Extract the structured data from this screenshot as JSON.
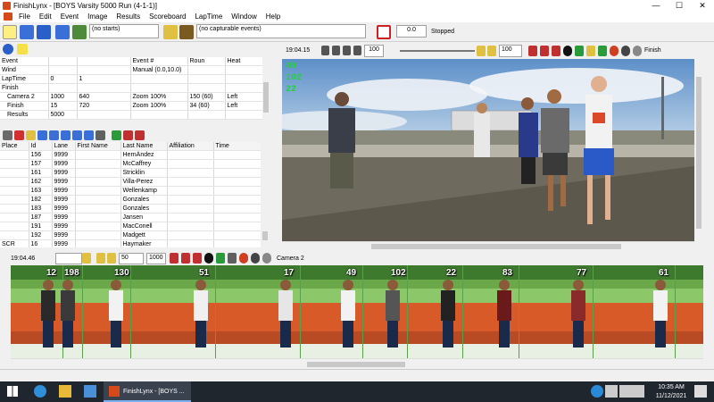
{
  "window": {
    "title": "FinishLynx - [BOYS  Varsity 5000 Run (4-1-1)]",
    "minimize": "—",
    "maximize": "☐",
    "close": "✕"
  },
  "menu": [
    "File",
    "Edit",
    "Event",
    "Image",
    "Results",
    "Scoreboard",
    "LapTime",
    "Window",
    "Help"
  ],
  "toolbar": {
    "starts_select": "(no starts)",
    "capture_select": "(no capturable events)",
    "time_value": "0.0",
    "status": "Stopped"
  },
  "event_panel": {
    "rows": [
      {
        "c0": "Event",
        "c1": "",
        "c2": "",
        "c3": "Event #",
        "c4": "Roun",
        "c5": "Heat"
      },
      {
        "c0": "Wind",
        "c1": "",
        "c2": "",
        "c3": "Manual (0.0,10.0)",
        "c4": "",
        "c5": ""
      },
      {
        "c0": "LapTime",
        "c1": "0",
        "c2": "1",
        "c3": "",
        "c4": "",
        "c5": ""
      },
      {
        "c0": "Finish",
        "c1": "",
        "c2": "",
        "c3": "",
        "c4": "",
        "c5": ""
      },
      {
        "c0": "Camera 2",
        "c1": "1000",
        "c2": "640",
        "c3": "Zoom 100%",
        "c4": "150  (60)",
        "c5": "Left"
      },
      {
        "c0": "Finish",
        "c1": "15",
        "c2": "720",
        "c3": "Zoom 100%",
        "c4": "34  (60)",
        "c5": "Left"
      },
      {
        "c0": "Results",
        "c1": "5000",
        "c2": "",
        "c3": "",
        "c4": "",
        "c5": ""
      }
    ]
  },
  "results": {
    "headers": [
      "Place",
      "Id",
      "Lane",
      "First Name",
      "Last Name",
      "Affiliation",
      "Time"
    ],
    "rows": [
      {
        "place": "",
        "id": "156",
        "lane": "9999",
        "first": "",
        "last": "HernÁndez",
        "aff": "",
        "time": ""
      },
      {
        "place": "",
        "id": "157",
        "lane": "9999",
        "first": "",
        "last": "McCaffrey",
        "aff": "",
        "time": ""
      },
      {
        "place": "",
        "id": "161",
        "lane": "9999",
        "first": "",
        "last": "Stricklin",
        "aff": "",
        "time": ""
      },
      {
        "place": "",
        "id": "162",
        "lane": "9999",
        "first": "",
        "last": "Villa-Perez",
        "aff": "",
        "time": ""
      },
      {
        "place": "",
        "id": "163",
        "lane": "9999",
        "first": "",
        "last": "Wellenkamp",
        "aff": "",
        "time": ""
      },
      {
        "place": "",
        "id": "182",
        "lane": "9999",
        "first": "",
        "last": "Gonzales",
        "aff": "",
        "time": ""
      },
      {
        "place": "",
        "id": "183",
        "lane": "9999",
        "first": "",
        "last": "Gonzales",
        "aff": "",
        "time": ""
      },
      {
        "place": "",
        "id": "187",
        "lane": "9999",
        "first": "",
        "last": "Jansen",
        "aff": "",
        "time": ""
      },
      {
        "place": "",
        "id": "191",
        "lane": "9999",
        "first": "",
        "last": "MacConell",
        "aff": "",
        "time": ""
      },
      {
        "place": "",
        "id": "192",
        "lane": "9999",
        "first": "",
        "last": "Madgett",
        "aff": "",
        "time": ""
      },
      {
        "place": "SCR",
        "id": "16",
        "lane": "9999",
        "first": "",
        "last": "Haymaker",
        "aff": "",
        "time": ""
      }
    ]
  },
  "camera": {
    "time": "19:04.15",
    "zoom": "100",
    "zoom2": "100",
    "label": "Finish",
    "overlay": [
      "49",
      "102",
      "22"
    ]
  },
  "strip": {
    "time": "19:04.46",
    "val1": "50",
    "val2": "1000",
    "label": "Camera 2",
    "bibs": [
      "12",
      "198",
      "130",
      "51",
      "17",
      "49",
      "102",
      "22",
      "83",
      "77",
      "61"
    ]
  },
  "taskbar": {
    "app": "FinishLynx - [BOYS ...",
    "time": "10:35 AM",
    "date": "11/12/2021"
  }
}
